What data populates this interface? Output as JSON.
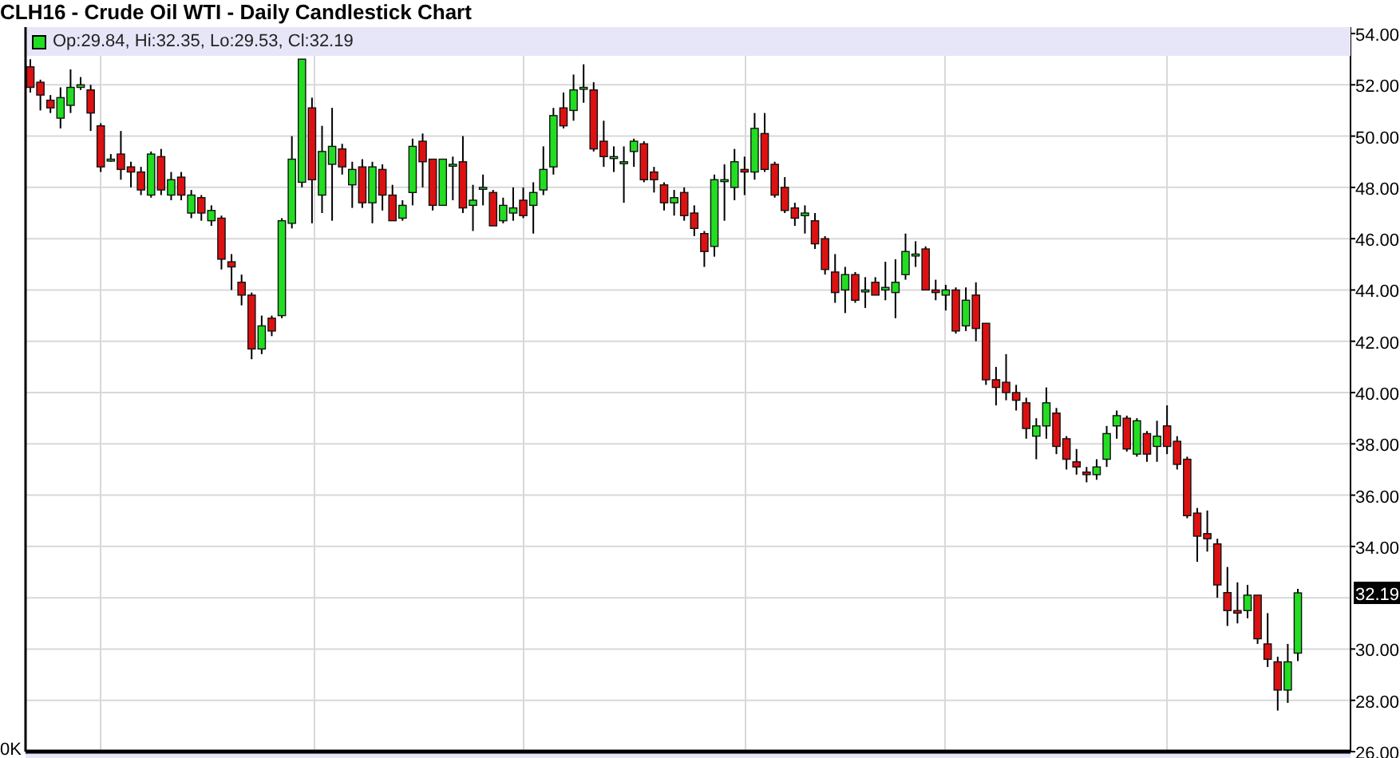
{
  "title": "CLH16 - Crude Oil WTI - Daily Candlestick Chart",
  "legend": "Op:29.84, Hi:32.35, Lo:29.53, Cl:32.19",
  "price_label": "32.19",
  "volume_label": "0K",
  "chart_data": {
    "type": "candlestick",
    "grid": true,
    "ylim": [
      26,
      54
    ],
    "yticks": [
      {
        "value": 54,
        "label": "54.00"
      },
      {
        "value": 52,
        "label": "52.00"
      },
      {
        "value": 50,
        "label": "50.00"
      },
      {
        "value": 48,
        "label": "48.00"
      },
      {
        "value": 46,
        "label": "46.00"
      },
      {
        "value": 44,
        "label": "44.00"
      },
      {
        "value": 42,
        "label": "42.00"
      },
      {
        "value": 40,
        "label": "40.00"
      },
      {
        "value": 38,
        "label": "38.00"
      },
      {
        "value": 36,
        "label": "36.00"
      },
      {
        "value": 34,
        "label": "34.00"
      },
      {
        "value": 30,
        "label": "30.00"
      },
      {
        "value": 28,
        "label": "28.00"
      },
      {
        "value": 26,
        "label": "26.00"
      }
    ],
    "categories": [
      null,
      null,
      null,
      null,
      null,
      null,
      null,
      null,
      null,
      null,
      null,
      null,
      null,
      null,
      null,
      null,
      null,
      null,
      null,
      null,
      null,
      null,
      null,
      null,
      null,
      null,
      null,
      null,
      null,
      null,
      null,
      null,
      null,
      null,
      null,
      null,
      null,
      null,
      null,
      null,
      null,
      null,
      null,
      null,
      null,
      null,
      null,
      null,
      null,
      null,
      null,
      null,
      null,
      null,
      null,
      null,
      null,
      null,
      null,
      null,
      null,
      null,
      null,
      null,
      null,
      null,
      null,
      null,
      null,
      null,
      null,
      null,
      null,
      null,
      null,
      null,
      null,
      null,
      null,
      null,
      null,
      null,
      null,
      null,
      null,
      null,
      null,
      null,
      null,
      null,
      null,
      null,
      null,
      null,
      null,
      null,
      null,
      null,
      null,
      null,
      null,
      null,
      null,
      null,
      null,
      null,
      null,
      null,
      null,
      null,
      null,
      null,
      null,
      null,
      null,
      null,
      null,
      null,
      null,
      null,
      null,
      null,
      null,
      null,
      null,
      null,
      null
    ],
    "ohlc": [
      [
        52.7,
        53.0,
        51.7,
        51.9
      ],
      [
        52.1,
        52.2,
        51.0,
        51.6
      ],
      [
        51.4,
        51.6,
        50.9,
        51.1
      ],
      [
        50.7,
        51.9,
        50.3,
        51.5
      ],
      [
        51.2,
        52.6,
        50.9,
        51.9
      ],
      [
        51.9,
        52.3,
        51.8,
        52.0
      ],
      [
        51.8,
        52.0,
        50.2,
        50.9
      ],
      [
        50.4,
        50.5,
        48.6,
        48.8
      ],
      [
        49.1,
        49.3,
        49.0,
        49.1
      ],
      [
        49.3,
        50.2,
        48.3,
        48.7
      ],
      [
        48.8,
        49.0,
        48.0,
        48.6
      ],
      [
        48.6,
        48.8,
        47.7,
        47.9
      ],
      [
        47.7,
        49.4,
        47.6,
        49.3
      ],
      [
        49.2,
        49.5,
        47.7,
        47.9
      ],
      [
        47.7,
        48.6,
        47.5,
        48.3
      ],
      [
        48.4,
        48.6,
        47.5,
        47.7
      ],
      [
        47.0,
        47.9,
        46.8,
        47.7
      ],
      [
        47.6,
        47.7,
        46.7,
        47.0
      ],
      [
        46.7,
        47.3,
        46.5,
        47.1
      ],
      [
        46.8,
        46.9,
        44.8,
        45.2
      ],
      [
        45.1,
        45.4,
        44.0,
        44.9
      ],
      [
        44.3,
        44.6,
        43.4,
        43.8
      ],
      [
        43.8,
        43.9,
        41.3,
        41.7
      ],
      [
        41.7,
        43.0,
        41.5,
        42.6
      ],
      [
        42.9,
        43.0,
        42.2,
        42.4
      ],
      [
        43.0,
        46.8,
        42.9,
        46.7
      ],
      [
        46.6,
        50.0,
        46.4,
        49.1
      ],
      [
        48.2,
        53.0,
        48.0,
        53.0
      ],
      [
        51.1,
        51.5,
        46.6,
        48.3
      ],
      [
        47.7,
        50.4,
        47.0,
        49.4
      ],
      [
        48.9,
        51.1,
        46.7,
        49.6
      ],
      [
        49.5,
        49.7,
        48.5,
        48.8
      ],
      [
        48.1,
        49.0,
        47.2,
        48.7
      ],
      [
        48.8,
        49.1,
        47.2,
        47.4
      ],
      [
        47.4,
        49.0,
        46.6,
        48.8
      ],
      [
        48.7,
        48.9,
        47.1,
        47.7
      ],
      [
        47.7,
        48.1,
        46.7,
        46.7
      ],
      [
        46.8,
        47.5,
        46.7,
        47.3
      ],
      [
        47.8,
        49.9,
        47.3,
        49.6
      ],
      [
        49.8,
        50.1,
        48.0,
        49.0
      ],
      [
        49.1,
        49.1,
        47.1,
        47.3
      ],
      [
        47.3,
        49.1,
        47.3,
        49.1
      ],
      [
        48.9,
        49.2,
        47.5,
        48.9
      ],
      [
        49.0,
        50.0,
        47.0,
        47.2
      ],
      [
        47.3,
        48.1,
        46.3,
        47.5
      ],
      [
        48.0,
        48.5,
        47.3,
        48.0
      ],
      [
        47.8,
        47.9,
        46.5,
        46.5
      ],
      [
        46.7,
        47.6,
        46.6,
        47.3
      ],
      [
        47.0,
        48.0,
        46.7,
        47.2
      ],
      [
        47.5,
        48.0,
        46.8,
        46.9
      ],
      [
        47.3,
        48.2,
        46.2,
        47.8
      ],
      [
        47.9,
        49.6,
        47.7,
        48.7
      ],
      [
        48.8,
        51.1,
        48.5,
        50.8
      ],
      [
        51.1,
        51.7,
        50.3,
        50.4
      ],
      [
        51.0,
        52.4,
        50.6,
        51.8
      ],
      [
        51.9,
        52.8,
        51.3,
        51.9
      ],
      [
        51.8,
        52.1,
        49.4,
        49.5
      ],
      [
        49.8,
        50.6,
        48.8,
        49.2
      ],
      [
        49.2,
        49.6,
        48.6,
        49.2
      ],
      [
        49.0,
        49.6,
        47.4,
        49.0
      ],
      [
        49.4,
        49.9,
        48.8,
        49.8
      ],
      [
        49.7,
        49.8,
        48.2,
        48.3
      ],
      [
        48.6,
        48.8,
        47.8,
        48.3
      ],
      [
        48.1,
        48.2,
        47.1,
        47.4
      ],
      [
        47.4,
        47.9,
        46.9,
        47.6
      ],
      [
        47.8,
        48.0,
        46.7,
        46.9
      ],
      [
        47.0,
        47.3,
        46.1,
        46.4
      ],
      [
        46.2,
        46.3,
        44.9,
        45.5
      ],
      [
        45.7,
        48.5,
        45.3,
        48.3
      ],
      [
        48.3,
        48.9,
        46.7,
        48.3
      ],
      [
        48.0,
        49.5,
        47.5,
        49.0
      ],
      [
        48.7,
        49.2,
        47.7,
        48.6
      ],
      [
        48.6,
        50.9,
        48.3,
        50.3
      ],
      [
        50.1,
        50.9,
        48.6,
        48.7
      ],
      [
        48.9,
        49.0,
        47.6,
        47.7
      ],
      [
        48.0,
        48.4,
        47.0,
        47.1
      ],
      [
        47.2,
        47.4,
        46.5,
        46.8
      ],
      [
        46.9,
        47.3,
        46.2,
        47.0
      ],
      [
        46.7,
        47.0,
        45.6,
        45.8
      ],
      [
        46.0,
        46.1,
        44.6,
        44.8
      ],
      [
        44.7,
        45.4,
        43.5,
        43.9
      ],
      [
        44.0,
        44.9,
        43.1,
        44.6
      ],
      [
        44.6,
        44.7,
        43.5,
        43.6
      ],
      [
        44.0,
        44.5,
        43.3,
        44.0
      ],
      [
        44.3,
        44.5,
        43.8,
        43.8
      ],
      [
        44.0,
        45.1,
        43.6,
        44.1
      ],
      [
        43.9,
        45.2,
        42.9,
        44.3
      ],
      [
        44.6,
        46.2,
        44.4,
        45.5
      ],
      [
        45.4,
        45.9,
        44.9,
        45.4
      ],
      [
        45.6,
        45.7,
        44.0,
        44.0
      ],
      [
        44.0,
        44.4,
        43.6,
        43.9
      ],
      [
        43.8,
        44.2,
        43.2,
        44.0
      ],
      [
        44.0,
        44.1,
        42.3,
        42.4
      ],
      [
        42.6,
        44.1,
        42.4,
        43.6
      ],
      [
        43.8,
        44.3,
        42.0,
        42.5
      ],
      [
        42.7,
        42.7,
        40.3,
        40.5
      ],
      [
        40.5,
        41.0,
        39.5,
        40.2
      ],
      [
        40.4,
        41.5,
        39.7,
        40.0
      ],
      [
        40.0,
        40.3,
        39.3,
        39.7
      ],
      [
        39.6,
        39.8,
        38.2,
        38.6
      ],
      [
        38.3,
        39.0,
        37.4,
        38.7
      ],
      [
        38.7,
        40.2,
        38.2,
        39.6
      ],
      [
        39.2,
        39.4,
        37.6,
        37.9
      ],
      [
        38.2,
        38.3,
        37.0,
        37.4
      ],
      [
        37.3,
        37.8,
        36.8,
        37.1
      ],
      [
        36.9,
        37.1,
        36.5,
        36.8
      ],
      [
        36.8,
        37.4,
        36.6,
        37.1
      ],
      [
        37.4,
        38.7,
        37.1,
        38.4
      ],
      [
        38.7,
        39.3,
        38.2,
        39.1
      ],
      [
        39.0,
        39.1,
        37.7,
        37.8
      ],
      [
        37.6,
        39.0,
        37.5,
        38.9
      ],
      [
        38.4,
        38.5,
        37.3,
        37.6
      ],
      [
        37.9,
        38.9,
        37.3,
        38.3
      ],
      [
        38.7,
        39.5,
        37.6,
        37.9
      ],
      [
        38.1,
        38.3,
        37.0,
        37.2
      ],
      [
        37.4,
        37.5,
        35.1,
        35.2
      ],
      [
        35.3,
        35.5,
        33.4,
        34.4
      ],
      [
        34.5,
        35.4,
        33.8,
        34.3
      ],
      [
        34.1,
        34.3,
        32.0,
        32.5
      ],
      [
        32.2,
        33.2,
        30.9,
        31.5
      ],
      [
        31.5,
        32.6,
        31.0,
        31.4
      ],
      [
        31.5,
        32.5,
        31.2,
        32.1
      ],
      [
        32.1,
        32.1,
        30.2,
        30.4
      ],
      [
        30.2,
        31.4,
        29.3,
        29.6
      ],
      [
        29.5,
        29.7,
        27.6,
        28.4
      ],
      [
        28.4,
        30.2,
        27.9,
        29.5
      ],
      [
        29.84,
        32.35,
        29.53,
        32.19
      ]
    ]
  }
}
